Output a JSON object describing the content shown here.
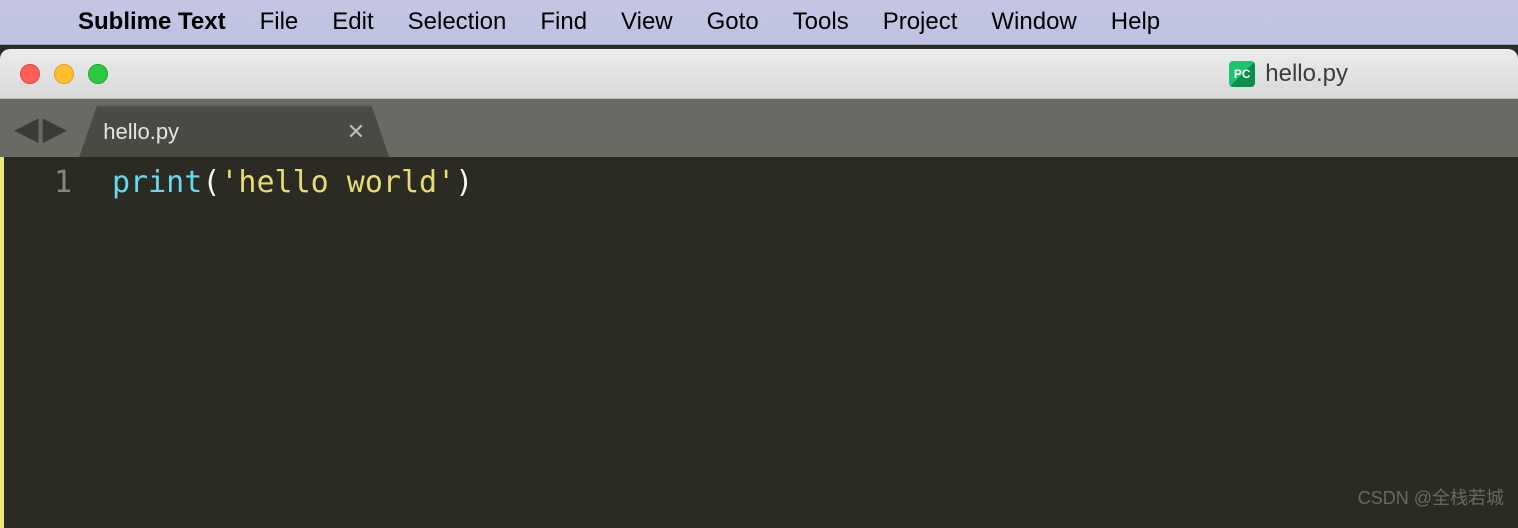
{
  "menubar": {
    "app_name": "Sublime Text",
    "items": [
      "File",
      "Edit",
      "Selection",
      "Find",
      "View",
      "Goto",
      "Tools",
      "Project",
      "Window",
      "Help"
    ]
  },
  "window": {
    "title_filename": "hello.py",
    "file_icon_label": "PC"
  },
  "tabs": [
    {
      "label": "hello.py"
    }
  ],
  "editor": {
    "lines": [
      {
        "num": "1",
        "tokens": {
          "func": "print",
          "open": "(",
          "str": "'hello world'",
          "close": ")"
        }
      }
    ]
  },
  "watermark": "CSDN @全栈若城"
}
